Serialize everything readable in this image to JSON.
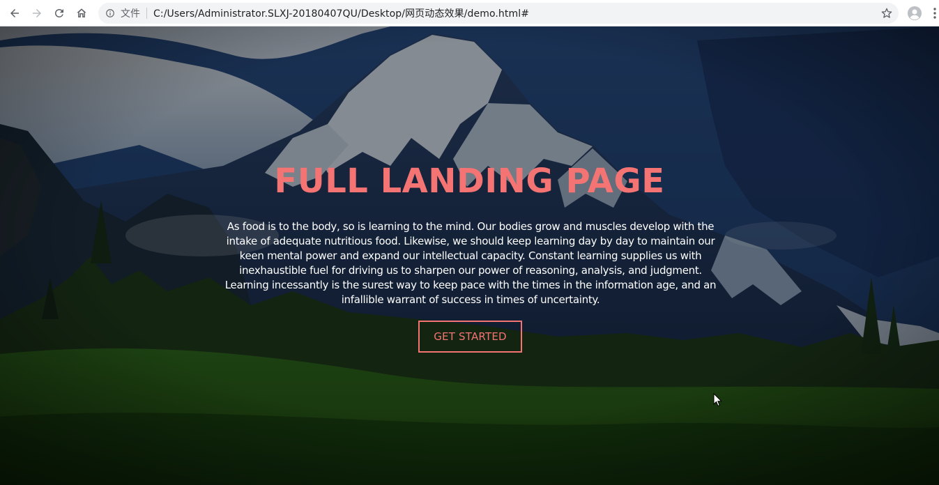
{
  "browser": {
    "scheme_label": "文件",
    "url": "C:/Users/Administrator.SLXJ-20180407QU/Desktop/网页动态效果/demo.html#",
    "icons": {
      "back": "arrow-left-icon",
      "forward": "arrow-right-icon",
      "reload": "reload-icon",
      "home": "home-icon",
      "info": "info-icon",
      "bookmark": "star-icon",
      "profile": "avatar-icon",
      "menu": "kebab-menu-icon"
    }
  },
  "hero": {
    "title": "FULL LANDING PAGE",
    "text": "As food is to the body, so is learning to the mind. Our bodies grow and muscles develop with the intake of adequate nutritious food. Likewise, we should keep learning day by day to maintain our keen mental power and expand our intellectual capacity. Constant learning supplies us with inexhaustible fuel for driving us to sharpen our power of reasoning, analysis, and judgment. Learning incessantly is the surest way to keep pace with the times in the information age, and an infallible warrant of success in times of uncertainty.",
    "cta_label": "GET STARTED",
    "accent_color": "#f47373",
    "background": "snowy-mountain-landscape"
  }
}
